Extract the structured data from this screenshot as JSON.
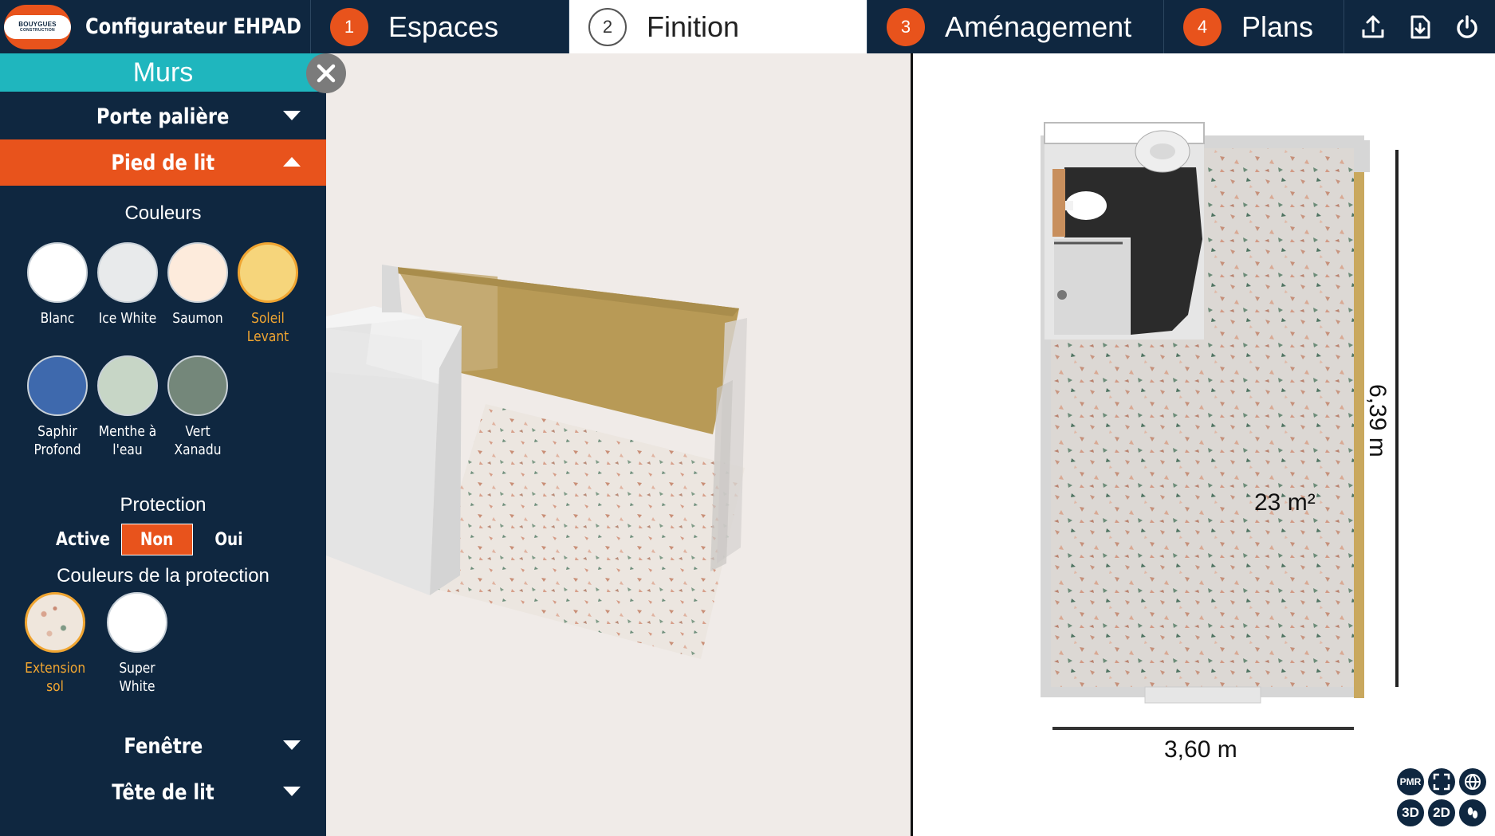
{
  "header": {
    "logo_line1": "BOUYGUES",
    "logo_line2": "CONSTRUCTION",
    "app_title": "Configurateur EHPAD",
    "steps": [
      {
        "num": "1",
        "label": "Espaces"
      },
      {
        "num": "2",
        "label": "Finition"
      },
      {
        "num": "3",
        "label": "Aménagement"
      },
      {
        "num": "4",
        "label": "Plans"
      }
    ],
    "active_step": "2",
    "actions": [
      "upload-icon",
      "save-icon",
      "power-icon"
    ]
  },
  "sidebar": {
    "panel_title": "Murs",
    "accordions": {
      "porte_paliere": "Porte palière",
      "pied_de_lit": "Pied de lit",
      "fenetre": "Fenêtre",
      "tete_de_lit": "Tête de lit"
    },
    "colors_title": "Couleurs",
    "colors": [
      {
        "name": "Blanc",
        "hex": "#ffffff"
      },
      {
        "name": "Ice White",
        "hex": "#e8eaeb"
      },
      {
        "name": "Saumon",
        "hex": "#fdebdc"
      },
      {
        "name": "Soleil\nLevant",
        "hex": "#f6d57b",
        "selected": true
      },
      {
        "name": "Saphir\nProfond",
        "hex": "#3e69ad"
      },
      {
        "name": "Menthe à\nl'eau",
        "hex": "#c7d6c6"
      },
      {
        "name": "Vert\nXanadu",
        "hex": "#74877a"
      }
    ],
    "protection_title": "Protection",
    "protection": {
      "label": "Active",
      "off": "Non",
      "on": "Oui",
      "selected": "Non"
    },
    "protection_colors_title": "Couleurs de la protection",
    "protection_colors": [
      {
        "name": "Extension\nsol",
        "hex": "#efe6dc",
        "selected": true
      },
      {
        "name": "Super\nWhite",
        "hex": "#ffffff"
      }
    ]
  },
  "plan": {
    "width_label": "3,60 m",
    "height_label": "6,39 m",
    "area_label": "23 m²"
  },
  "view_tools": [
    "PMR",
    "fullscreen-icon",
    "globe-icon",
    "3D",
    "2D",
    "footprint-icon"
  ],
  "colors": {
    "navy": "#0f2740",
    "orange": "#e8531c",
    "teal": "#1fb6be",
    "selected_gold": "#f0a531"
  }
}
